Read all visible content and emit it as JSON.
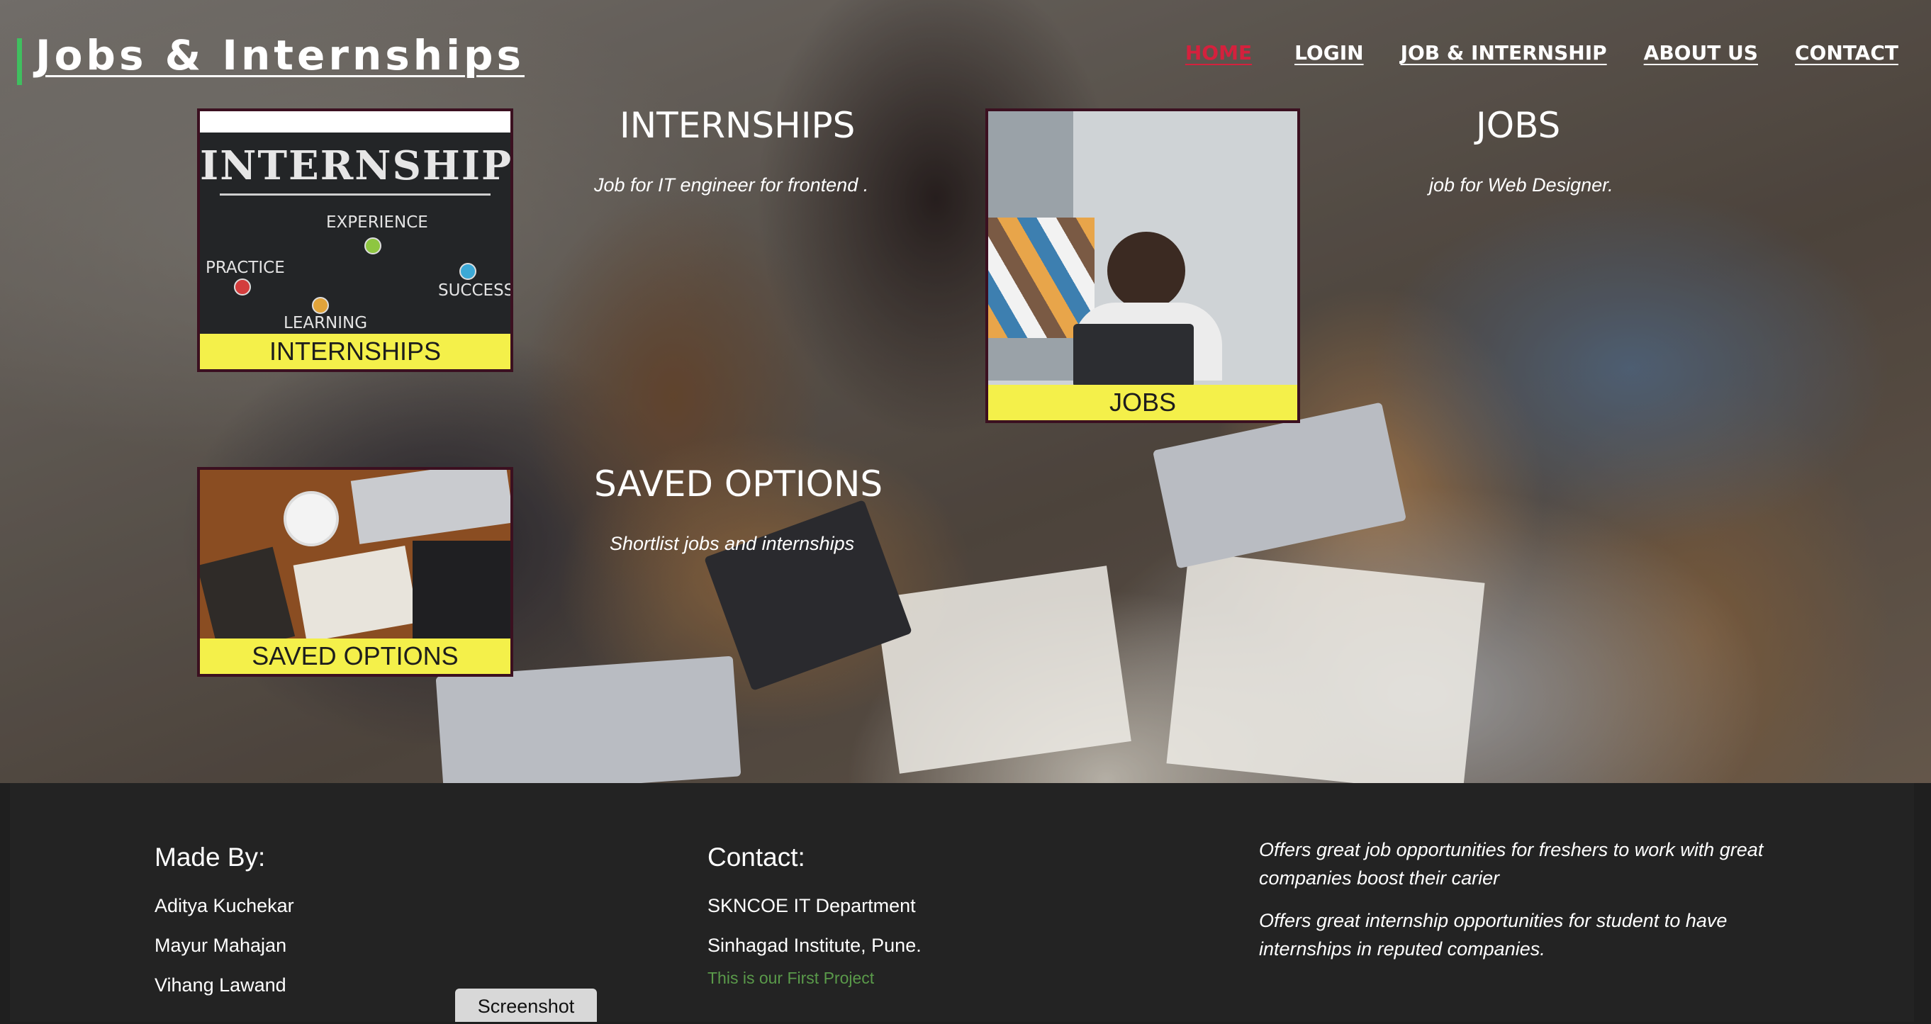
{
  "header": {
    "brand": "Jobs & Internships",
    "nav": {
      "home": "HOME",
      "login": " LOGIN",
      "jobs_internship": "JOB & INTERNSHIP",
      "about": "ABOUT US",
      "contact": "CONTACT"
    },
    "active_color": "#d4213d"
  },
  "cards": {
    "internship": {
      "label": "INTERNSHIPS",
      "chalk_title": "INTERNSHIP",
      "chalk_words": [
        "PRACTICE",
        "EXPERIENCE",
        "SUCCESS",
        "LEARNING"
      ]
    },
    "jobs": {
      "label": "JOBS"
    },
    "saved": {
      "label": "SAVED OPTIONS"
    }
  },
  "sections": {
    "internships": {
      "title": "INTERNSHIPS",
      "subtitle": "Job for IT engineer for frontend ."
    },
    "jobs": {
      "title": "JOBS",
      "subtitle": "job for Web Designer."
    },
    "saved": {
      "title": "SAVED OPTIONS",
      "subtitle": "Shortlist jobs and internships"
    }
  },
  "footer": {
    "made_by": {
      "heading": "Made By:",
      "names": [
        "Aditya Kuchekar",
        "Mayur Mahajan",
        "Vihang Lawand"
      ]
    },
    "contact": {
      "heading": "Contact:",
      "lines": [
        "SKNCOE IT Department",
        "Sinhagad Institute, Pune."
      ],
      "note": "This is our First Project"
    },
    "offers": [
      "Offers great job opportunities for freshers to work with great companies boost their carier",
      "Offers great internship opportunities for student to have internships in reputed companies."
    ]
  },
  "screenshot_button": "Screenshot",
  "colors": {
    "accent_green": "#3fbf5f",
    "card_label_yellow": "#f4f04a",
    "footer_bg": "#232323",
    "note_green": "#5a9a4a"
  }
}
